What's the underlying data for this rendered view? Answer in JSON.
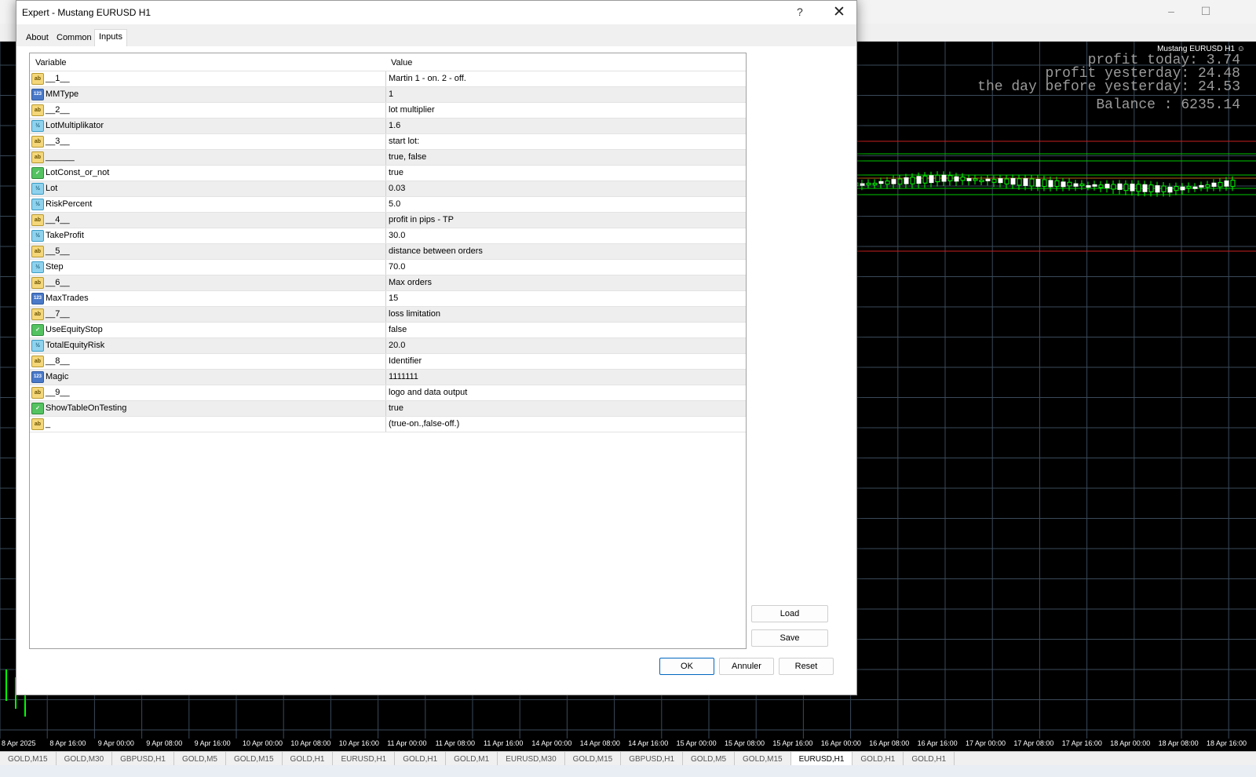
{
  "dialog": {
    "title": "Expert - Mustang EURUSD H1",
    "help_glyph": "?",
    "close_glyph": "✕",
    "tabs": [
      {
        "label": "About"
      },
      {
        "label": "Common"
      },
      {
        "label": "Inputs"
      }
    ],
    "active_tab": "Inputs",
    "grid": {
      "headers": {
        "variable": "Variable",
        "value": "Value"
      },
      "rows": [
        {
          "type": "ab",
          "name": "__1__",
          "value": "Martin 1 - on. 2 - off."
        },
        {
          "type": "123",
          "name": "MMType",
          "value": "1"
        },
        {
          "type": "ab",
          "name": "__2__",
          "value": "lot multiplier"
        },
        {
          "type": "v2",
          "name": "LotMultiplikator",
          "value": "1.6"
        },
        {
          "type": "ab",
          "name": "__3__",
          "value": "start lot:"
        },
        {
          "type": "ab",
          "name": "______",
          "value": "true, false"
        },
        {
          "type": "bool",
          "name": "LotConst_or_not",
          "value": "true"
        },
        {
          "type": "v2",
          "name": "Lot",
          "value": "0.03"
        },
        {
          "type": "v2",
          "name": "RiskPercent",
          "value": "5.0"
        },
        {
          "type": "ab",
          "name": "__4__",
          "value": "profit in pips - TP"
        },
        {
          "type": "v2",
          "name": "TakeProfit",
          "value": "30.0"
        },
        {
          "type": "ab",
          "name": "__5__",
          "value": "distance between orders"
        },
        {
          "type": "v2",
          "name": "Step",
          "value": "70.0"
        },
        {
          "type": "ab",
          "name": "__6__",
          "value": "Max orders"
        },
        {
          "type": "123",
          "name": "MaxTrades",
          "value": "15"
        },
        {
          "type": "ab",
          "name": "__7__",
          "value": "loss limitation"
        },
        {
          "type": "bool",
          "name": "UseEquityStop",
          "value": "false"
        },
        {
          "type": "v2",
          "name": "TotalEquityRisk",
          "value": "20.0"
        },
        {
          "type": "ab",
          "name": "__8__",
          "value": "Identifier"
        },
        {
          "type": "123",
          "name": "Magic",
          "value": "1111111"
        },
        {
          "type": "ab",
          "name": "__9__",
          "value": "logo and data output"
        },
        {
          "type": "bool",
          "name": "ShowTableOnTesting",
          "value": "true"
        },
        {
          "type": "ab",
          "name": "_",
          "value": "(true-on.,false-off.)"
        }
      ]
    },
    "buttons": {
      "load": "Load",
      "save": "Save",
      "ok": "OK",
      "cancel": "Annuler",
      "reset": "Reset"
    }
  },
  "icon_labels": {
    "ab": "ab",
    "123": "123",
    "v2": "½",
    "bool": "✓"
  },
  "chart": {
    "title": "Mustang EURUSD H1 ☺",
    "stats": {
      "profit_today": "profit today: 3.74",
      "profit_yesterday": "profit yesterday: 24.48",
      "profit_day_before": "the day before yesterday: 24.53",
      "balance": "Balance : 6235.14"
    },
    "time_axis": [
      "8 Apr 2025",
      "8 Apr 16:00",
      "9 Apr 00:00",
      "9 Apr 08:00",
      "9 Apr 16:00",
      "10 Apr 00:00",
      "10 Apr 08:00",
      "10 Apr 16:00",
      "11 Apr 00:00",
      "11 Apr 08:00",
      "11 Apr 16:00",
      "14 Apr 00:00",
      "14 Apr 08:00",
      "14 Apr 16:00",
      "15 Apr 00:00",
      "15 Apr 08:00",
      "15 Apr 16:00",
      "16 Apr 00:00",
      "16 Apr 08:00",
      "16 Apr 16:00",
      "17 Apr 00:00",
      "17 Apr 08:00",
      "17 Apr 16:00",
      "18 Apr 00:00",
      "18 Apr 08:00",
      "18 Apr 16:00"
    ],
    "colors": {
      "background": "#000000",
      "grid": "#3a4a5a",
      "bull": "#ffffff",
      "bear": "#00ff00",
      "order_line": "#00c800",
      "stop_line": "#c81e1e"
    }
  },
  "symbol_tabs": [
    {
      "label": "GOLD,M15"
    },
    {
      "label": "GOLD,M30"
    },
    {
      "label": "GBPUSD,H1"
    },
    {
      "label": "GOLD,M5"
    },
    {
      "label": "GOLD,M15"
    },
    {
      "label": "GOLD,H1"
    },
    {
      "label": "EURUSD,H1"
    },
    {
      "label": "GOLD,H1"
    },
    {
      "label": "GOLD,M1"
    },
    {
      "label": "EURUSD,M30"
    },
    {
      "label": "GOLD,M15"
    },
    {
      "label": "GBPUSD,H1"
    },
    {
      "label": "GOLD,M5"
    },
    {
      "label": "GOLD,M15"
    },
    {
      "label": "EURUSD,H1",
      "active": true
    },
    {
      "label": "GOLD,H1"
    },
    {
      "label": "GOLD,H1"
    }
  ]
}
